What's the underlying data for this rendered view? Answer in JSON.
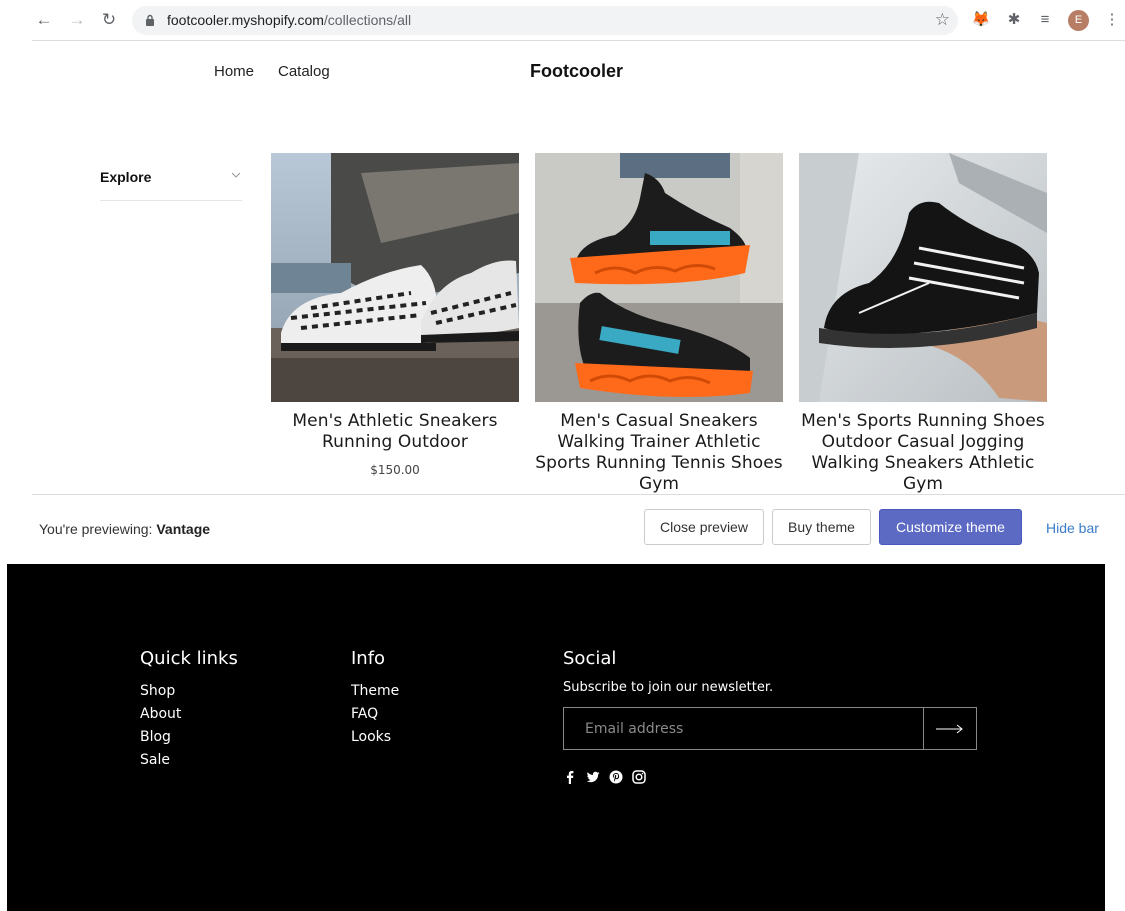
{
  "browser": {
    "url_host": "footcooler.myshopify.com",
    "url_path": "/collections/all",
    "avatar_initial": "E"
  },
  "header": {
    "nav": [
      {
        "label": "Home"
      },
      {
        "label": "Catalog"
      }
    ],
    "brand": "Footcooler"
  },
  "sidebar": {
    "filter_label": "Explore"
  },
  "products": [
    {
      "title": "Men's Athletic Sneakers Running Outdoor",
      "price": "$150.00",
      "image": "white-black-patterned-sneakers"
    },
    {
      "title": "Men's Casual Sneakers Walking Trainer Athletic Sports Running Tennis Shoes Gym",
      "price": "",
      "image": "black-orange-fashion-sneakers"
    },
    {
      "title": "Men's Sports Running Shoes Outdoor Casual Jogging Walking Sneakers Athletic Gym",
      "price": "",
      "image": "black-sneaker-in-hand"
    }
  ],
  "preview_bar": {
    "prefix": "You're previewing: ",
    "theme_name": "Vantage",
    "close_label": "Close preview",
    "buy_label": "Buy theme",
    "customize_label": "Customize theme",
    "hide_label": "Hide bar",
    "accent_color": "#5c6ac4"
  },
  "footer": {
    "quick_links": {
      "heading": "Quick links",
      "items": [
        "Shop",
        "About",
        "Blog",
        "Sale"
      ]
    },
    "info": {
      "heading": "Info",
      "items": [
        "Theme",
        "FAQ",
        "Looks"
      ]
    },
    "social": {
      "heading": "Social",
      "subscribe_text": "Subscribe to join our newsletter.",
      "email_placeholder": "Email address",
      "icons": [
        "facebook-icon",
        "twitter-icon",
        "pinterest-icon",
        "instagram-icon"
      ]
    }
  }
}
